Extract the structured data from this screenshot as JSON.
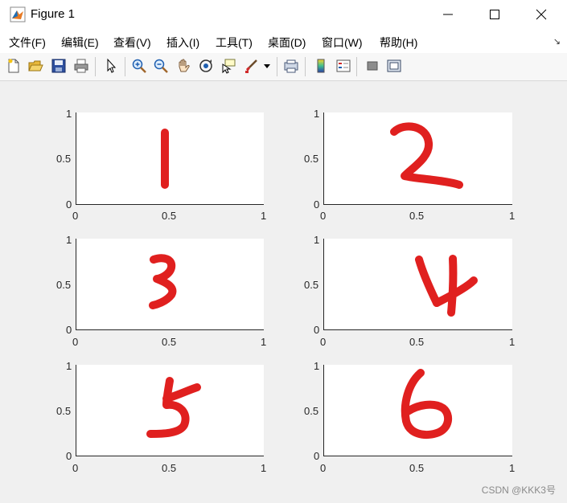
{
  "window": {
    "title": "Figure 1",
    "controls": {
      "minimize": "minimize",
      "maximize": "maximize",
      "close": "close"
    }
  },
  "menu": {
    "items": [
      "文件(F)",
      "编辑(E)",
      "查看(V)",
      "插入(I)",
      "工具(T)",
      "桌面(D)",
      "窗口(W)",
      "帮助(H)"
    ],
    "overflow_arrow": "↘"
  },
  "toolbar": {
    "icons": [
      "new-figure-icon",
      "open-file-icon",
      "save-icon",
      "print-icon",
      "select-arrow-icon",
      "zoom-in-icon",
      "zoom-out-icon",
      "pan-hand-icon",
      "rotate-3d-icon",
      "data-cursor-icon",
      "brush-icon",
      "brush-dropdown-icon",
      "link-plot-icon",
      "colorbar-icon",
      "legend-icon",
      "hide-plot-tools-icon",
      "show-plot-tools-icon"
    ]
  },
  "axes_ticks": {
    "x": [
      "0",
      "0.5",
      "1"
    ],
    "y": [
      "0",
      "0.5",
      "1"
    ]
  },
  "subplots": [
    {
      "digit": "1",
      "ink_color": "#e0201f"
    },
    {
      "digit": "2",
      "ink_color": "#e0201f"
    },
    {
      "digit": "3",
      "ink_color": "#e0201f"
    },
    {
      "digit": "4",
      "ink_color": "#e0201f"
    },
    {
      "digit": "5",
      "ink_color": "#e0201f"
    },
    {
      "digit": "6",
      "ink_color": "#e0201f"
    }
  ],
  "watermark": "CSDN @KKK3号",
  "colors": {
    "axes_bg": "#ffffff",
    "figure_bg": "#f0f0f0",
    "ink": "#e0201f"
  }
}
